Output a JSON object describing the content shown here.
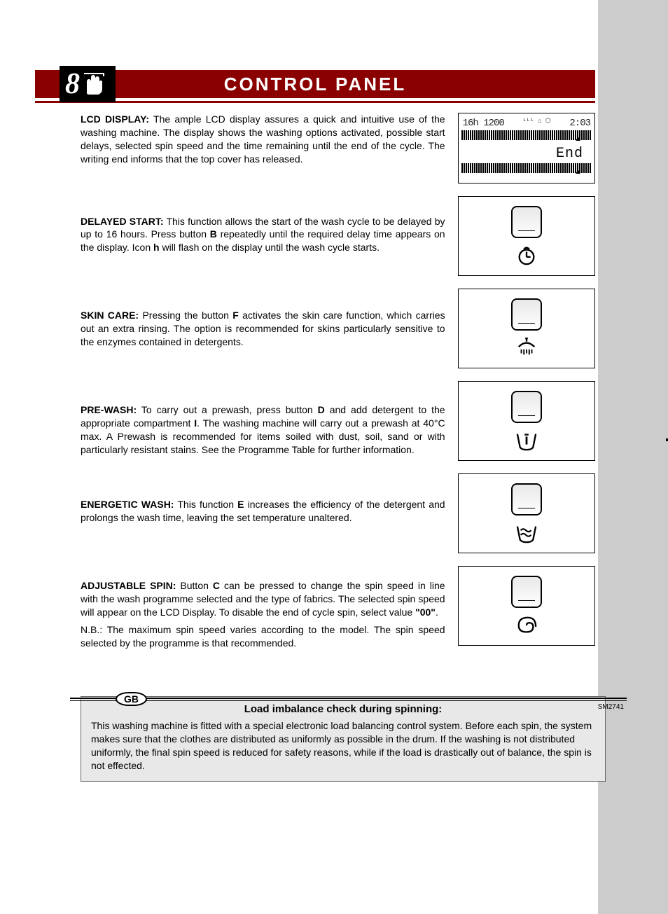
{
  "header": {
    "page_number": "8",
    "title": "CONTROL PANEL"
  },
  "sections": {
    "lcd": {
      "label": "LCD DISPLAY:",
      "text": "The ample LCD display assures a quick and intuitive use of the washing machine. The display shows the washing options activated, possible start delays, selected spin speed and the time remaining until the end of the cycle. The writing end informs that the top cover has released."
    },
    "delayed": {
      "label": "DELAYED START:",
      "text_a": "This function allows the start of the wash cycle to be delayed by up to 16 hours. Press button ",
      "bold_b": "B",
      "text_b": " repeatedly until the required delay time appears on the display. Icon ",
      "bold_h": "h",
      "text_c": " will flash on the display until the wash cycle starts."
    },
    "skin": {
      "label": "SKIN CARE:",
      "text_a": "Pressing the button ",
      "bold_f": "F",
      "text_b": " activates the skin care function, which carries out an extra rinsing. The option is recommended for skins particularly sensitive to the enzymes contained in detergents."
    },
    "prewash": {
      "label": "PRE-WASH:",
      "text_a": "To carry out a prewash, press button ",
      "bold_d": "D",
      "text_b": " and add detergent to the appropriate compartment ",
      "bold_i": "I",
      "text_c": ". The washing machine will carry out a prewash at 40°C max. A Prewash is recommended for items soiled with dust, soil, sand or with particularly resistant stains. See the Programme Table for further information."
    },
    "energetic": {
      "label": "ENERGETIC WASH:",
      "text_a": "This function ",
      "bold_e": "E",
      "text_b": " increases the efficiency of the detergent and prolongs the wash time, leaving the set temperature unaltered."
    },
    "spin": {
      "label": "ADJUSTABLE SPIN:",
      "text_a": "Button ",
      "bold_c": "C",
      "text_b": " can be pressed to change the spin speed in line with the wash programme selected and the type of fabrics. The selected spin speed will appear on the LCD Display. To disable the end of cycle spin, select value ",
      "bold_00": "\"00\"",
      "text_c": ".",
      "nb": "N.B.: The maximum spin speed varies according to the model. The spin speed selected by the programme is that recommended."
    }
  },
  "lcd_display": {
    "line1_left": "16h 1200",
    "line1_right": "2:03",
    "end_text": "End"
  },
  "note": {
    "title": "Load imbalance check during spinning:",
    "body": "This washing machine is fitted with a special electronic load balancing control system. Before each spin, the system makes sure that the clothes are distributed as uniformly as possible in the drum. If the washing is not distributed uniformly, the final spin speed is reduced for safety reasons, while if the load is drastically out of balance, the spin is not effected."
  },
  "footer": {
    "country": "GB",
    "doc_code": "SM2741"
  }
}
